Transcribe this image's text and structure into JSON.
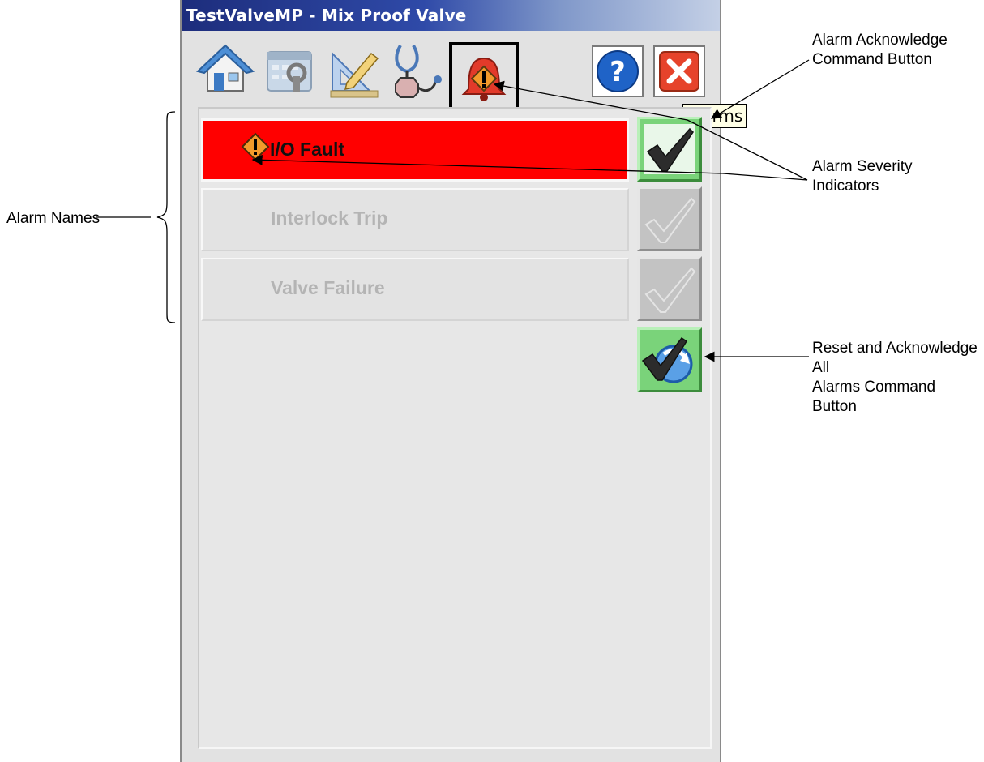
{
  "window": {
    "title": "TestValveMP - Mix Proof Valve"
  },
  "toolbar": {
    "tabs": [
      {
        "icon": "home-icon"
      },
      {
        "icon": "maintenance-icon"
      },
      {
        "icon": "engineering-icon"
      },
      {
        "icon": "diagnostics-icon"
      },
      {
        "icon": "alarms-icon",
        "tooltip": "Alarms",
        "selected": true
      }
    ],
    "help_icon": "help-icon",
    "close_icon": "close-icon"
  },
  "alarms": [
    {
      "name": "I/O Fault",
      "active": true,
      "severity_icon": "alarm-severity-icon"
    },
    {
      "name": "Interlock Trip",
      "active": false
    },
    {
      "name": "Valve Failure",
      "active": false
    }
  ],
  "buttons": {
    "ack_icon": "checkmark-icon",
    "reset_ack_all_icon": "reset-acknowledge-all-icon"
  },
  "callouts": {
    "alarm_names": "Alarm Names",
    "alarm_ack_line1": "Alarm Acknowledge",
    "alarm_ack_line2": "Command Button",
    "severity_line1": "Alarm Severity",
    "severity_line2": "Indicators",
    "reset_line1": "Reset and Acknowledge All",
    "reset_line2": "Alarms Command Button"
  },
  "colors": {
    "active_alarm": "#ff0000",
    "title_bar": "#2f4aa8",
    "ack_enabled": "#7ad37a",
    "ack_disabled": "#c3c3c3"
  }
}
